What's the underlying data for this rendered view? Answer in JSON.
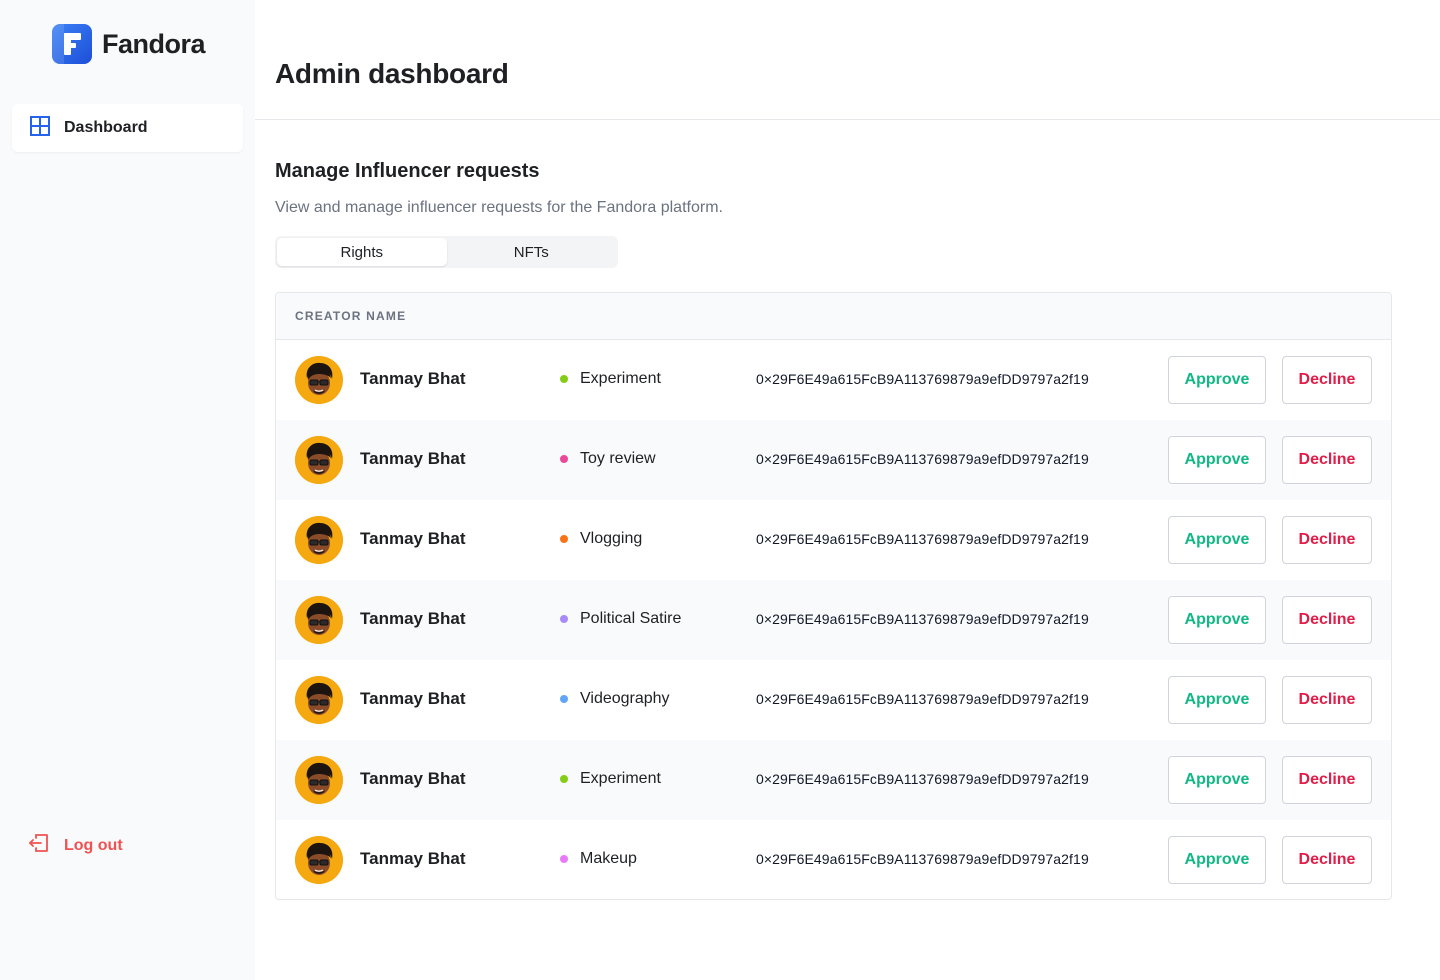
{
  "brand": {
    "name": "Fandora",
    "accent": "#2563eb"
  },
  "sidebar": {
    "items": [
      {
        "label": "Dashboard",
        "icon": "grid-icon",
        "active": true
      }
    ],
    "logout_label": "Log out",
    "logout_color": "#f05252"
  },
  "header": {
    "title": "Admin dashboard"
  },
  "section": {
    "title": "Manage Influencer requests",
    "subtitle": "View and manage influencer requests for the Fandora platform."
  },
  "tabs": [
    {
      "label": "Rights",
      "active": true
    },
    {
      "label": "NFTs",
      "active": false
    }
  ],
  "table": {
    "column_header": "CREATOR NAME",
    "approve_label": "Approve",
    "decline_label": "Decline",
    "rows": [
      {
        "name": "Tanmay Bhat",
        "category": "Experiment",
        "dot_color": "#84cc16",
        "address": "0×29F6E49a615FcB9A113769879a9efDD9797a2f19"
      },
      {
        "name": "Tanmay Bhat",
        "category": "Toy review",
        "dot_color": "#ec4899",
        "address": "0×29F6E49a615FcB9A113769879a9efDD9797a2f19"
      },
      {
        "name": "Tanmay Bhat",
        "category": "Vlogging",
        "dot_color": "#f97316",
        "address": "0×29F6E49a615FcB9A113769879a9efDD9797a2f19"
      },
      {
        "name": "Tanmay Bhat",
        "category": "Political Satire",
        "dot_color": "#a78bfa",
        "address": "0×29F6E49a615FcB9A113769879a9efDD9797a2f19"
      },
      {
        "name": "Tanmay Bhat",
        "category": "Videography",
        "dot_color": "#60a5fa",
        "address": "0×29F6E49a615FcB9A113769879a9efDD9797a2f19"
      },
      {
        "name": "Tanmay Bhat",
        "category": "Experiment",
        "dot_color": "#84cc16",
        "address": "0×29F6E49a615FcB9A113769879a9efDD9797a2f19"
      },
      {
        "name": "Tanmay Bhat",
        "category": "Makeup",
        "dot_color": "#e879f9",
        "address": "0×29F6E49a615FcB9A113769879a9efDD9797a2f19"
      }
    ]
  }
}
